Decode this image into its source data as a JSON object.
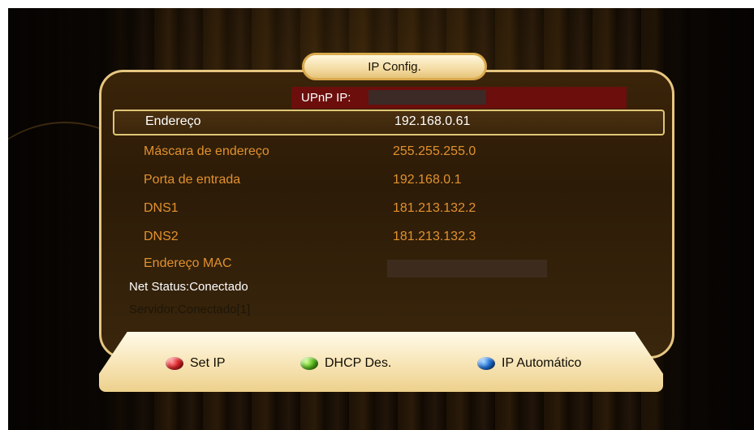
{
  "title": "IP Config.",
  "upnp_label": "UPnP IP:",
  "rows": [
    {
      "label": "Endereço",
      "value": "192.168.0.61"
    },
    {
      "label": "Máscara de endereço",
      "value": "255.255.255.0"
    },
    {
      "label": "Porta de entrada",
      "value": "192.168.0.1"
    },
    {
      "label": "DNS1",
      "value": "181.213.132.2"
    },
    {
      "label": "DNS2",
      "value": "181.213.132.3"
    },
    {
      "label": "Endereço MAC",
      "value": ""
    }
  ],
  "net_status": "Net Status:Conectado",
  "server_status": "Servidor:Conectado[1]",
  "buttons": {
    "red": {
      "label": "Set IP",
      "icon": "red-button-icon"
    },
    "green": {
      "label": "DHCP Des.",
      "icon": "green-button-icon"
    },
    "blue": {
      "label": "IP Automático",
      "icon": "blue-button-icon"
    }
  },
  "colors": {
    "accent_orange": "#e2912e",
    "panel_border": "#e7c680",
    "upnp_bar": "#6b0e0c"
  }
}
